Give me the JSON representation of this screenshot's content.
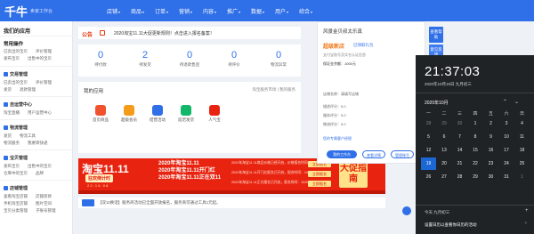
{
  "header": {
    "logo": "千牛",
    "logo_sub": "卖家工作台",
    "nav": [
      {
        "label": "店铺"
      },
      {
        "label": "商品"
      },
      {
        "label": "订单"
      },
      {
        "label": "营销"
      },
      {
        "label": "内容"
      },
      {
        "label": "推广"
      },
      {
        "label": "数据"
      },
      {
        "label": "用户"
      },
      {
        "label": "综合"
      }
    ],
    "search_placeholder": "搜索"
  },
  "sidebar": {
    "title": "我们的应用",
    "common_title": "常用操作",
    "common_rows": [
      [
        "已卖出的宝贝",
        "评价管理"
      ],
      [
        "发布宝贝",
        "出售中的宝贝"
      ]
    ],
    "sections": [
      {
        "title": "交易管理",
        "rows": [
          [
            "已卖出的宝贝",
            "评价管理"
          ],
          [
            "发货",
            "退款管理"
          ]
        ]
      },
      {
        "title": "自运营中心",
        "rows": [
          [
            "淘宝直播",
            "用户运营中心"
          ]
        ]
      },
      {
        "title": "物流管理",
        "rows": [
          [
            "发货",
            "物流工具"
          ],
          [
            "物流服务",
            "我要寄快递"
          ]
        ]
      },
      {
        "title": "宝贝管理",
        "rows": [
          [
            "发布宝贝",
            "出售中的宝贝"
          ],
          [
            "仓库中的宝贝",
            "品牌"
          ]
        ]
      },
      {
        "title": "店铺管理",
        "rows": [
          [
            "查看淘宝店铺",
            "店铺装修"
          ],
          [
            "手机淘宝店铺",
            "图片空间"
          ],
          [
            "宝贝分类管理",
            "子账号管理"
          ]
        ]
      }
    ]
  },
  "notice": {
    "tag": "公告",
    "text": "2020淘宝11.11大促更新规则！点击进入报名备案！"
  },
  "stats": [
    {
      "num": "0",
      "label": "待付款"
    },
    {
      "num": "2",
      "label": "待发货"
    },
    {
      "num": "0",
      "label": "待退款售后"
    },
    {
      "num": "0",
      "label": "待评价"
    },
    {
      "num": "0",
      "label": "物流异常"
    }
  ],
  "apps": {
    "title": "我的应用",
    "more": "淘宝服务市场 | 我的服务",
    "items": [
      {
        "label": "首页商品",
        "color": "#f0522d"
      },
      {
        "label": "超级会员",
        "color": "#f49c1a"
      },
      {
        "label": "结营活动",
        "color": "#2f6fe8"
      },
      {
        "label": "延迟发货",
        "color": "#12b76a"
      },
      {
        "label": "人气宝",
        "color": "#e8230f"
      }
    ]
  },
  "banner": {
    "logo": "淘宝11.11",
    "badge": "狂欢倒计时",
    "countdown": "2 2 : 1 6 : 0 8",
    "events": [
      "2020年淘宝11.11",
      "2020年淘宝11.11开门红",
      "2020年淘宝11.11正在双11"
    ],
    "descs": [
      "2020年淘宝11.11商品价格已经开启，价格报名时间：10/15",
      "2020年淘宝11.11开门红报名已开启，报名时间：10/22",
      "2020年淘宝11.11正式报名已开启，报名时间：10/26"
    ],
    "buttons": [
      "立即报名",
      "立即报名",
      "立即报名"
    ],
    "side": "大促指南"
  },
  "bottom_notice": "【双11换话】服务商活动已全面开放报名，服务商可通过工具1元起。",
  "popup": {
    "name": "风景金贝叔太乐真",
    "tag": "超级新店",
    "tag_status": "已领取礼包",
    "line1": "支付宝账号及实名认证信息",
    "line2": "保证金余额：1000元",
    "rows": [
      {
        "label": "店铺名称：",
        "value": "请填写店铺"
      },
      {
        "label": "描述评分：",
        "value": "5.0"
      },
      {
        "label": "服务评分：",
        "value": "5.0"
      },
      {
        "label": "物流评分：",
        "value": "5.0"
      }
    ],
    "helper": "您的专属客户经理",
    "btn1": "我的工作台",
    "btn2": "查看详情",
    "btn3": "管理账号"
  },
  "floating": [
    {
      "label": "查看帮助"
    },
    {
      "label": "意见反馈"
    }
  ],
  "clock": {
    "time": "21:37:03",
    "date": "2020年10月19日 九月初三",
    "month": "2020年10月",
    "weekdays": [
      "一",
      "二",
      "三",
      "四",
      "五",
      "六",
      "日"
    ],
    "days": [
      {
        "d": "28",
        "dim": true
      },
      {
        "d": "29",
        "dim": true
      },
      {
        "d": "30",
        "dim": true
      },
      {
        "d": "1"
      },
      {
        "d": "2"
      },
      {
        "d": "3"
      },
      {
        "d": "4"
      },
      {
        "d": "5"
      },
      {
        "d": "6"
      },
      {
        "d": "7"
      },
      {
        "d": "8"
      },
      {
        "d": "9"
      },
      {
        "d": "10"
      },
      {
        "d": "11"
      },
      {
        "d": "12"
      },
      {
        "d": "13"
      },
      {
        "d": "14"
      },
      {
        "d": "15"
      },
      {
        "d": "16"
      },
      {
        "d": "17"
      },
      {
        "d": "18"
      },
      {
        "d": "19",
        "today": true
      },
      {
        "d": "20"
      },
      {
        "d": "21"
      },
      {
        "d": "22"
      },
      {
        "d": "23"
      },
      {
        "d": "24"
      },
      {
        "d": "25"
      },
      {
        "d": "26"
      },
      {
        "d": "27"
      },
      {
        "d": "28"
      },
      {
        "d": "29"
      },
      {
        "d": "30"
      },
      {
        "d": "31"
      },
      {
        "d": "1",
        "dim": true
      }
    ],
    "events_header": "今天 九月初三",
    "event": "设置日历以查看你日历的活动"
  }
}
